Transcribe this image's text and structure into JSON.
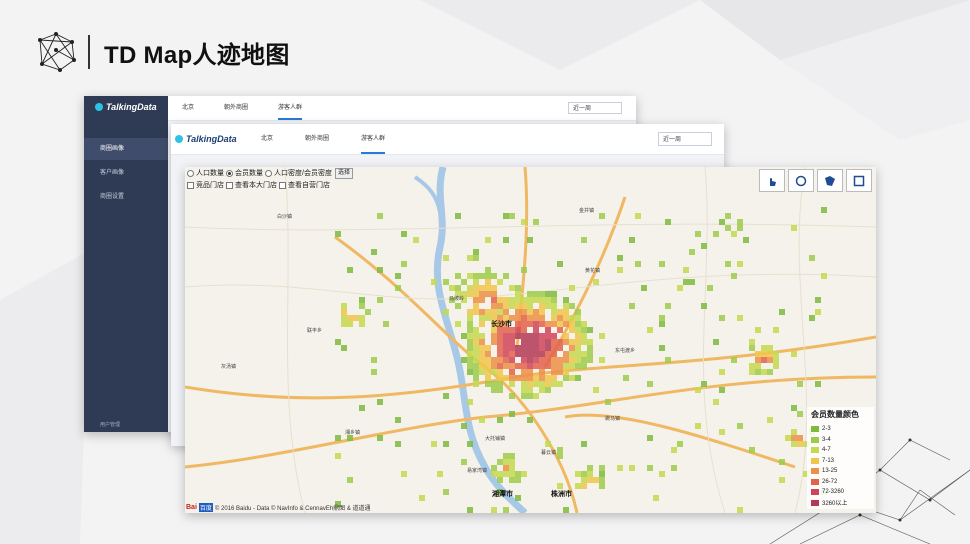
{
  "slide": {
    "title": "TD Map人迹地图"
  },
  "back_window": {
    "brand": "TalkingData",
    "sidebar": [
      "商圈画像",
      "客户画像",
      "商圈设置"
    ],
    "sidebar_footer": "用户管理",
    "nav": [
      "北京",
      "朝外商圈",
      "游客人群"
    ],
    "date": "近一周"
  },
  "mid_window": {
    "brand": "TalkingData",
    "nav": [
      "北京",
      "朝外商圈",
      "游客人群"
    ],
    "date": "近一周"
  },
  "map": {
    "radios": [
      "人口数量",
      "会员数量",
      "人口密度/会员密度"
    ],
    "select_button": "选择",
    "checkboxes": [
      "竞品门店",
      "查看本大门店",
      "查看自营门店"
    ],
    "tool_icons": [
      "hand-pointer-icon",
      "circle-icon",
      "polygon-icon",
      "rectangle-icon"
    ],
    "legend": {
      "title": "会员数量颜色",
      "items": [
        {
          "label": "2-3",
          "color": "#7dbb3e"
        },
        {
          "label": "3-4",
          "color": "#9ccb4a"
        },
        {
          "label": "4-7",
          "color": "#c3d94e"
        },
        {
          "label": "7-13",
          "color": "#f0c64a"
        },
        {
          "label": "13-25",
          "color": "#ec9148"
        },
        {
          "label": "26-72",
          "color": "#e3624a"
        },
        {
          "label": "72-3260",
          "color": "#d0445a"
        },
        {
          "label": "3260以上",
          "color": "#b23a55"
        }
      ]
    },
    "copyright": "© 2016 Baidu - Data © NavInfo & CennavEh鼎图 & 道道通",
    "baidu_logo_text": "Bai",
    "baidu_logo_badge": "百度",
    "cities": [
      "长沙市",
      "湘潭市",
      "株洲市"
    ],
    "places": [
      "白沙镇",
      "联丰乡",
      "东屯渡乡",
      "灰汤镇",
      "大托铺镇",
      "暮云镇",
      "马坡岭",
      "跳马镇",
      "易家湾镇",
      "湘乡镇",
      "黄花镇",
      "金井镇"
    ]
  }
}
